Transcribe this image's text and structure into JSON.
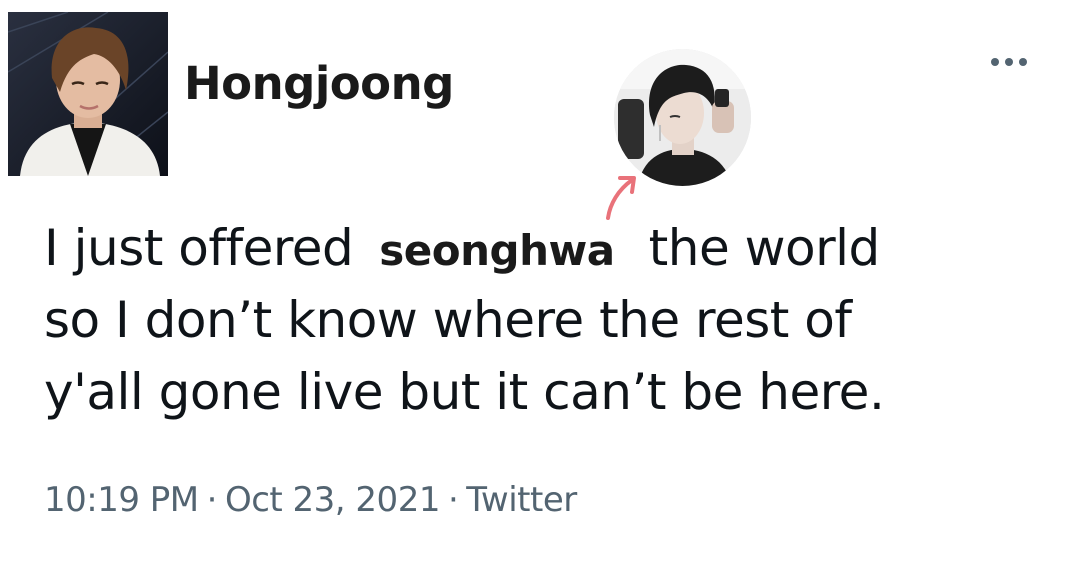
{
  "author": {
    "display_name": "Hongjoong",
    "avatar": "profile-photo"
  },
  "mention_photo": "profile-photo-circle",
  "more_icon": "more-horizontal-icon",
  "arrow_icon": "arrow-up-right-icon",
  "tweet": {
    "line1_before": "I just offered",
    "mention": "seonghwa",
    "line1_after": "the world",
    "line2": "so I don’t know where the rest of",
    "line3": "y'all gone live but it can’t be here."
  },
  "meta": {
    "time": "10:19 PM",
    "separator": "·",
    "date": "Oct 23, 2021",
    "source": "Twitter"
  },
  "colors": {
    "text": "#0f1419",
    "secondary": "#536471",
    "arrow": "#e9727a",
    "background": "#ffffff"
  }
}
